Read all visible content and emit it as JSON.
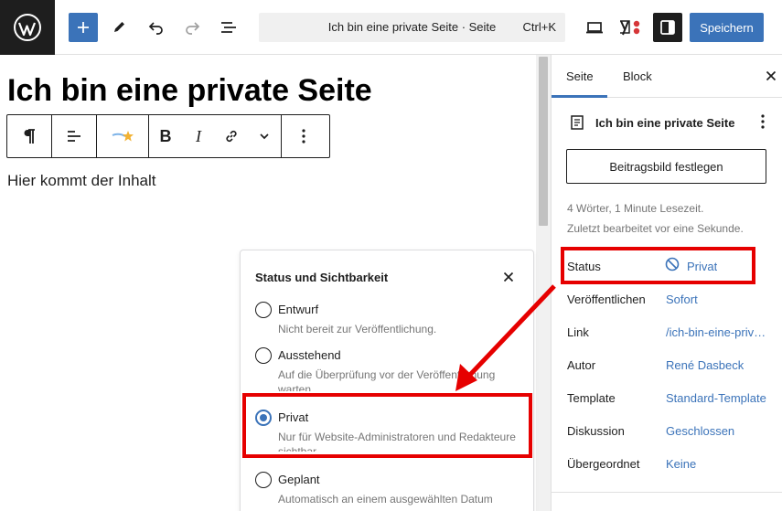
{
  "toolbar": {
    "logo_icon": "wordpress-logo",
    "add_icon": "plus-icon",
    "tools_icon": "pencil-icon",
    "undo_icon": "undo-icon",
    "redo_icon": "redo-icon",
    "outline_icon": "list-view-icon",
    "command_title": "Ich bin eine private Seite · Seite",
    "command_shortcut": "Ctrl+K",
    "preview_icon": "desktop-icon",
    "yoast_icon": "yoast-icon",
    "settings_icon": "sidebar-icon",
    "save_label": "Speichern"
  },
  "editor": {
    "heading": "Ich bin eine private Seite",
    "paragraph": "Hier kommt der Inhalt",
    "block_toolbar": {
      "paragraph_icon": "pilcrow-icon",
      "align_icon": "align-left-icon",
      "ai_icon": "ai-assistant-icon",
      "bold": "B",
      "italic": "I",
      "link_icon": "link-icon",
      "more_icon": "chevron-down-icon",
      "options_icon": "more-vertical-icon"
    }
  },
  "status_popover": {
    "title": "Status und Sichtbarkeit",
    "close_icon": "close-icon",
    "options": [
      {
        "label": "Entwurf",
        "description": "Nicht bereit zur Veröffentlichung.",
        "checked": false
      },
      {
        "label": "Ausstehend",
        "description": "Auf die Überprüfung vor der Veröffentlichung warten.",
        "checked": false
      },
      {
        "label": "Privat",
        "description": "Nur für Website-Administratoren und Redakteure sichtbar.",
        "checked": true
      },
      {
        "label": "Geplant",
        "description": "Automatisch an einem ausgewählten Datum",
        "checked": false
      }
    ]
  },
  "sidebar": {
    "tabs": [
      {
        "label": "Seite",
        "active": true
      },
      {
        "label": "Block",
        "active": false
      }
    ],
    "close_icon": "close-icon",
    "doc_title": "Ich bin eine private Seite",
    "doc_icon": "page-icon",
    "doc_menu_icon": "more-vertical-icon",
    "featured_image_button": "Beitragsbild festlegen",
    "word_count": "4 Wörter, 1 Minute Lesezeit.",
    "last_edited": "Zuletzt bearbeitet vor eine Sekunde.",
    "rows": [
      {
        "label": "Status",
        "value": "Privat"
      },
      {
        "label": "Veröffentlichen",
        "value": "Sofort"
      },
      {
        "label": "Link",
        "value": "/ich-bin-eine-private-seite/"
      },
      {
        "label": "Autor",
        "value": "René Dasbeck"
      },
      {
        "label": "Template",
        "value": "Standard-Template"
      },
      {
        "label": "Diskussion",
        "value": "Geschlossen"
      },
      {
        "label": "Übergeordnet",
        "value": "Keine"
      }
    ],
    "status_icon": "not-allowed-icon"
  },
  "colors": {
    "accent": "#3b73b9",
    "highlight": "#e60000",
    "dark": "#1e1e1e"
  }
}
